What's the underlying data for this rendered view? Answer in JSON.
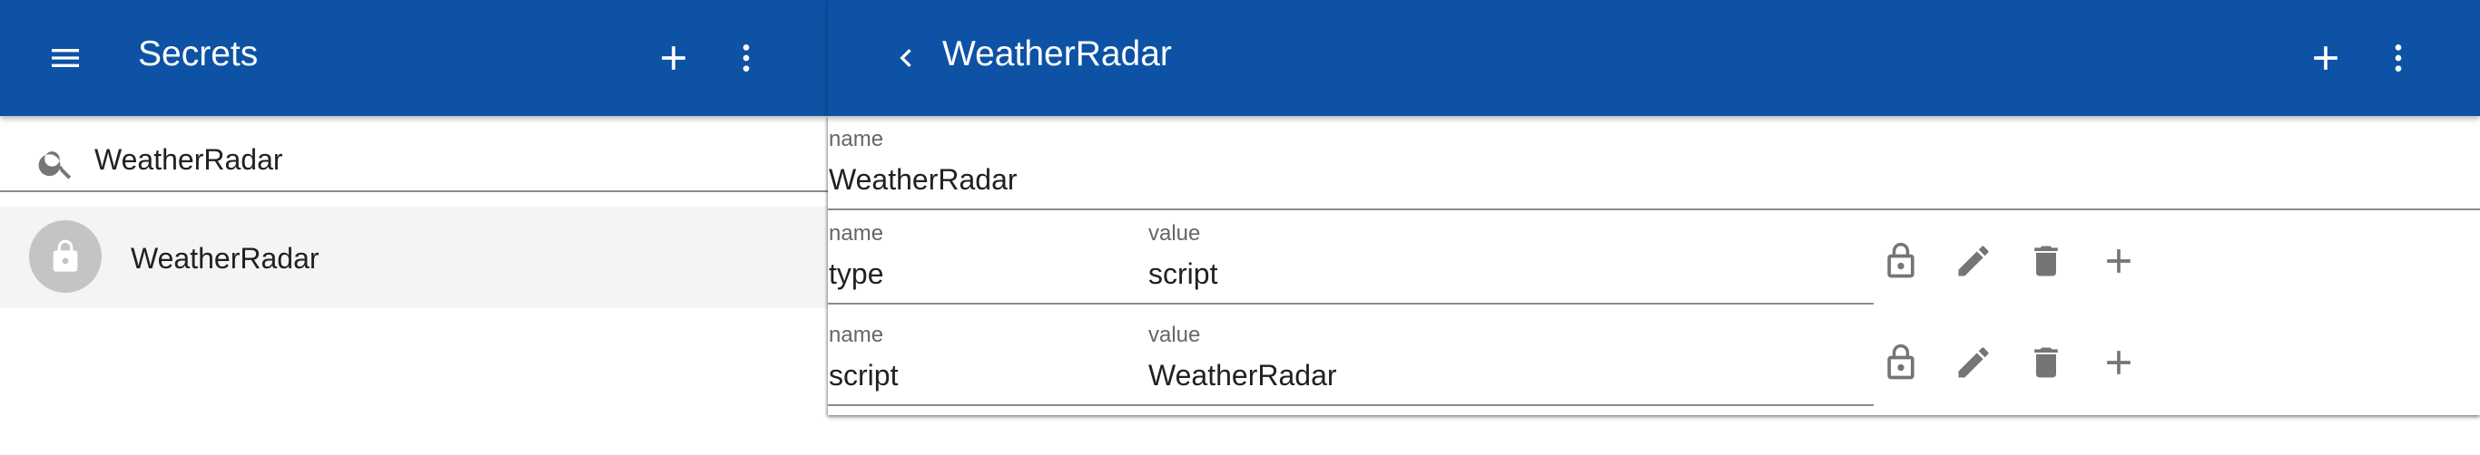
{
  "sidebar": {
    "title": "Secrets",
    "menu_icon": "hamburger-menu-icon",
    "add_icon": "plus-icon",
    "more_icon": "more-vertical-icon",
    "search": {
      "icon": "search-icon",
      "value": "WeatherRadar"
    },
    "items": [
      {
        "icon": "lock-icon",
        "label": "WeatherRadar",
        "selected": true
      }
    ]
  },
  "detail": {
    "title": "WeatherRadar",
    "back_icon": "chevron-left-icon",
    "add_icon": "plus-icon",
    "more_icon": "more-vertical-icon",
    "name_field": {
      "label": "name",
      "value": "WeatherRadar"
    },
    "rows": [
      {
        "name_label": "name",
        "name": "type",
        "value_label": "value",
        "value": "script",
        "actions": [
          "lock-open-icon",
          "pencil-icon",
          "trash-icon",
          "plus-icon"
        ]
      },
      {
        "name_label": "name",
        "name": "script",
        "value_label": "value",
        "value": "WeatherRadar",
        "actions": [
          "lock-open-icon",
          "pencil-icon",
          "trash-icon",
          "plus-icon"
        ]
      }
    ]
  },
  "colors": {
    "app_bar": "#0d52a4",
    "on_app_bar": "#ffffff",
    "icon_grey": "#757575",
    "selected_row": "#f4f4f4",
    "avatar": "#c4c4c4"
  }
}
